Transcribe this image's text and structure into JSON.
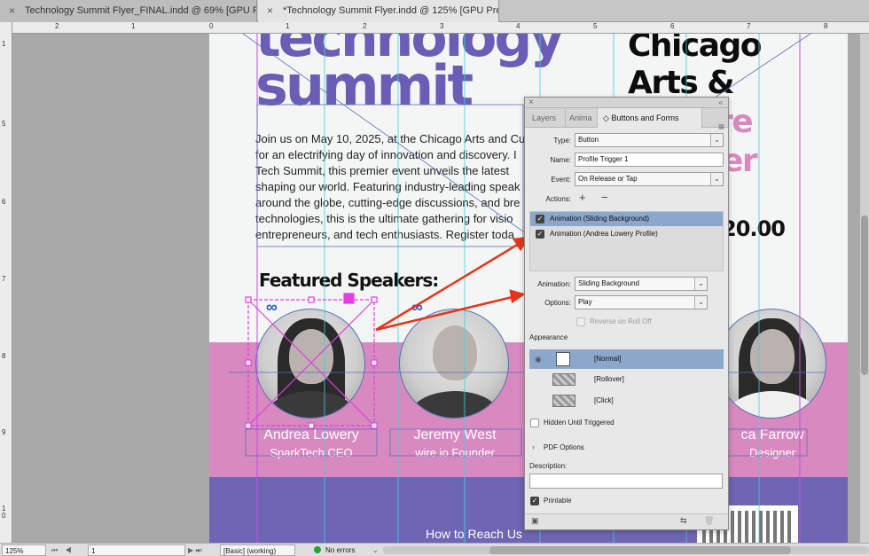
{
  "tabs": [
    {
      "close": "×",
      "title": "Technology Summit Flyer_FINAL.indd @ 69% [GPU Preview]"
    },
    {
      "close": "×",
      "title": "*Technology Summit Flyer.indd @ 125% [GPU Preview]"
    }
  ],
  "ruler": {
    "h": [
      "2",
      "1",
      "0",
      "1",
      "2",
      "3",
      "4",
      "5",
      "6",
      "7",
      "8"
    ],
    "v": [
      "1",
      "5",
      "6",
      "7",
      "8",
      "9",
      "1\n0"
    ]
  },
  "flyer": {
    "hero_top": "technology",
    "hero_bottom": "summit",
    "venue_line1": "Chicago",
    "venue_line2": "Arts &",
    "venue_pink1": "re",
    "venue_pink2": "er",
    "price": "20.00",
    "body_lines": [
      "Join us on May 10, 2025, at the Chicago Arts and Cu",
      "for an electrifying day of innovation and discovery. I",
      "Tech Summit, this premier event unveils the latest",
      "shaping our world. Featuring industry-leading speak",
      "around the globe, cutting-edge discussions, and bre",
      "technologies, this is the ultimate gathering for visio",
      "entrepreneurs, and tech enthusiasts. Register toda"
    ],
    "speakers_heading": "Featured Speakers:",
    "speakers": [
      {
        "name": "Andrea Lowery",
        "role": "SparkTech CEO"
      },
      {
        "name": "Jeremy West",
        "role": "wire.io Founder"
      },
      {
        "name": "ca Farrow",
        "role": "Designer"
      }
    ],
    "reach_heading": "How to Reach Us"
  },
  "panel": {
    "close": "×",
    "collapse": "«",
    "tabs": [
      "Layers",
      "Anima",
      "Buttons and Forms"
    ],
    "active_tab_prefix": "◇",
    "menu": "≡",
    "type_label": "Type:",
    "type_value": "Button",
    "name_label": "Name:",
    "name_value": "Profile Trigger 1",
    "event_label": "Event:",
    "event_value": "On Release or Tap",
    "actions_label": "Actions:",
    "add_action": "+",
    "remove_action": "−",
    "actions": [
      {
        "label": "Animation (Sliding Background)",
        "checked": true
      },
      {
        "label": "Animation (Andrea Lowery Profile)",
        "checked": true
      }
    ],
    "animation_label": "Animation:",
    "animation_value": "Sliding Background",
    "options_label": "Options:",
    "options_value": "Play",
    "reverse_label": "Reverse on Roll Off",
    "appearance_title": "Appearance",
    "states": [
      {
        "label": "[Normal]"
      },
      {
        "label": "[Rollover]"
      },
      {
        "label": "[Click]"
      }
    ],
    "hidden_label": "Hidden Until Triggered",
    "pdf_options_title": "PDF Options",
    "description_label": "Description:",
    "description_value": "",
    "printable_label": "Printable",
    "check_glyph": "✓",
    "eye_glyph": "◉",
    "pdf_caret": "›",
    "preview_glyph": "▣",
    "convert_glyph": "⇆",
    "trash_glyph": "🗑"
  },
  "statusbar": {
    "zoom": "125%",
    "nav_left": "⏮ ◀",
    "page": "1",
    "nav_right": "▶ ⏭",
    "open": "◐",
    "preflight_profile": "[Basic] (working)",
    "errors": "No errors",
    "errors_caret": "⌄"
  },
  "colors": {
    "hero_purple": "#6b5db5",
    "accent_pink": "#d889c0",
    "band_purple": "#6e66b4",
    "selection_magenta": "#e040e0",
    "guide_cyan": "#40d0e0",
    "arrow_red": "#e5341c",
    "panel_highlight": "#8ba7cc",
    "status_ok": "#1ca83a"
  },
  "chevron_glyph": "⌄"
}
